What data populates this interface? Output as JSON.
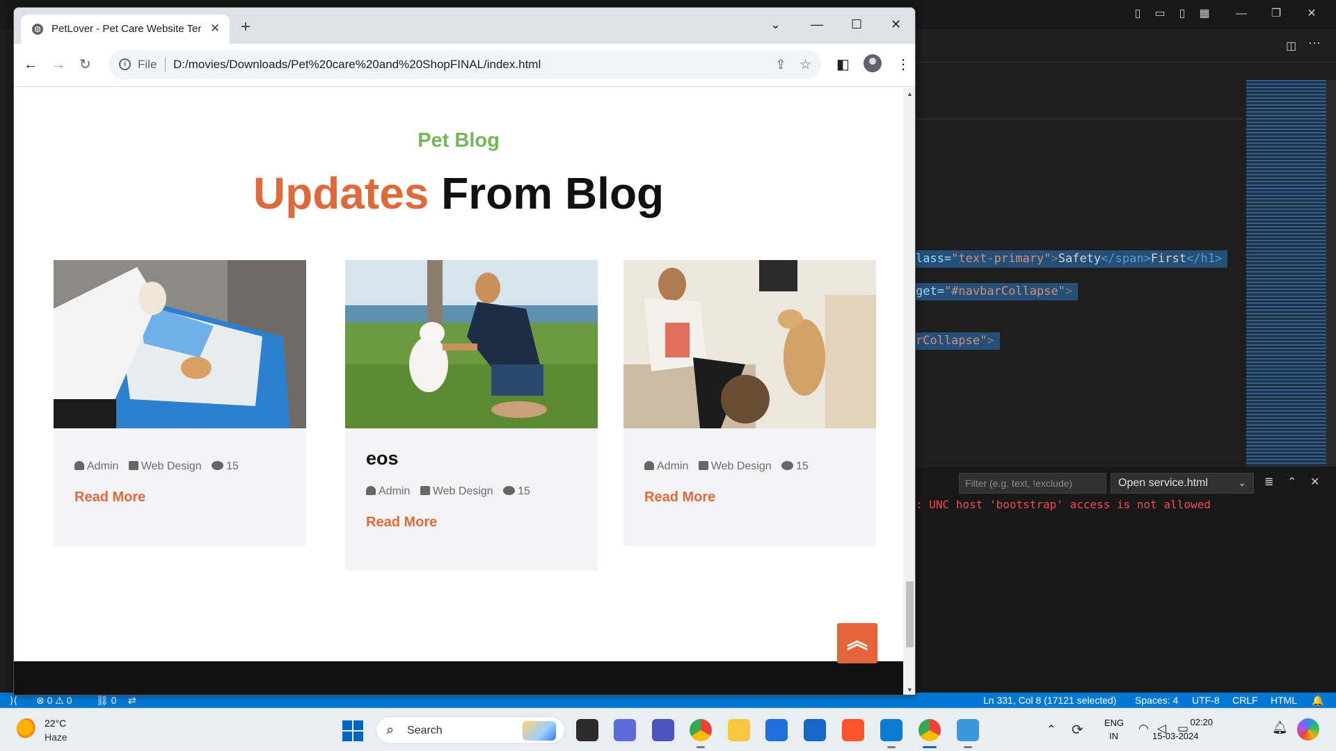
{
  "vscode": {
    "code_lines": [
      {
        "attr": "lass=",
        "str": "\"text-primary\"",
        "open": ">",
        "text1": "Safety",
        "close_tag": "</span>",
        "text2": "First",
        "end": "</h1>"
      },
      {
        "attr": "get=",
        "str": "\"#navbarCollapse\"",
        "open": ">"
      },
      {
        "str": "rCollapse\"",
        "open": ">"
      }
    ],
    "panel": {
      "filter_placeholder": "Filter (e.g. text, !exclude)",
      "select_value": "Open service.html",
      "error_text": ": UNC host 'bootstrap' access is not allowed"
    },
    "statusbar": {
      "problems": "⊗ 0 ⚠ 0",
      "ports": "⛓ 0",
      "cursor": "Ln 331, Col 8 (17121 selected)",
      "spaces": "Spaces: 4",
      "encoding": "UTF-8",
      "eol": "CRLF",
      "language": "HTML"
    }
  },
  "browser": {
    "tab_title": "PetLover - Pet Care Website Template",
    "omnibox_scheme": "File",
    "omnibox_url": "D:/movies/Downloads/Pet%20care%20and%20ShopFINAL/index.html",
    "window_controls": [
      "⌄",
      "—",
      "☐",
      "✕"
    ]
  },
  "page": {
    "section_subtitle": "Pet Blog",
    "section_title_accent": "Updates",
    "section_title_rest": " From Blog",
    "cards": [
      {
        "author": "Admin",
        "category": "Web Design",
        "comments": "15",
        "read_more": "Read More",
        "heading": ""
      },
      {
        "author": "Admin",
        "category": "Web Design",
        "comments": "15",
        "read_more": "Read More",
        "heading": "eos"
      },
      {
        "author": "Admin",
        "category": "Web Design",
        "comments": "15",
        "read_more": "Read More",
        "heading": ""
      }
    ],
    "back_to_top_icon": "double-chevron-up-icon"
  },
  "taskbar": {
    "weather_temp": "22°C",
    "weather_desc": "Haze",
    "search_placeholder": "Search",
    "lang_line1": "ENG",
    "lang_line2": "IN",
    "time": "02:20",
    "date": "15-03-2024"
  },
  "colors": {
    "accent_orange": "#de6a3b",
    "subtitle_green": "#77b55a",
    "vscode_status_blue": "#0078d4"
  }
}
